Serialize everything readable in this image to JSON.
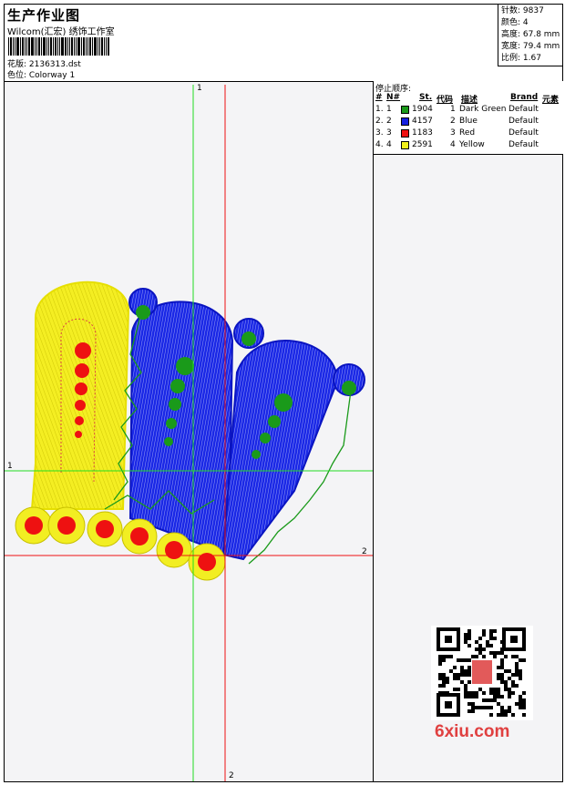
{
  "header": {
    "title": "生产作业图",
    "company": "Wilcom(汇宏) 绣饰工作室",
    "design_label": "花版: 2136313.dst",
    "colorway_label": "色位: Colorway 1"
  },
  "stats": {
    "stitches": "针数: 9837",
    "colors": "颜色: 4",
    "height": "高度: 67.8 mm",
    "width": "宽度: 79.4 mm",
    "scale": "比例: 1.67"
  },
  "stop_sequence": {
    "title": "停止顺序:",
    "columns": [
      "#",
      "N#",
      "St.",
      "代码",
      "描述",
      "Brand",
      "元素"
    ],
    "rows": [
      {
        "num": "1.",
        "needle": "1",
        "color": "#1a9a1a",
        "stitches": "1904",
        "code": "1",
        "desc": "Dark Green",
        "brand": "Default"
      },
      {
        "num": "2.",
        "needle": "2",
        "color": "#1420e0",
        "stitches": "4157",
        "code": "2",
        "desc": "Blue",
        "brand": "Default"
      },
      {
        "num": "3.",
        "needle": "3",
        "color": "#ee1111",
        "stitches": "1183",
        "code": "3",
        "desc": "Red",
        "brand": "Default"
      },
      {
        "num": "4.",
        "needle": "4",
        "color": "#f2f01a",
        "stitches": "2591",
        "code": "4",
        "desc": "Yellow",
        "brand": "Default"
      }
    ]
  },
  "axes": {
    "v1": "1",
    "h1": "1",
    "h2": "2",
    "v2": "2"
  },
  "watermark": "6xiu.com"
}
